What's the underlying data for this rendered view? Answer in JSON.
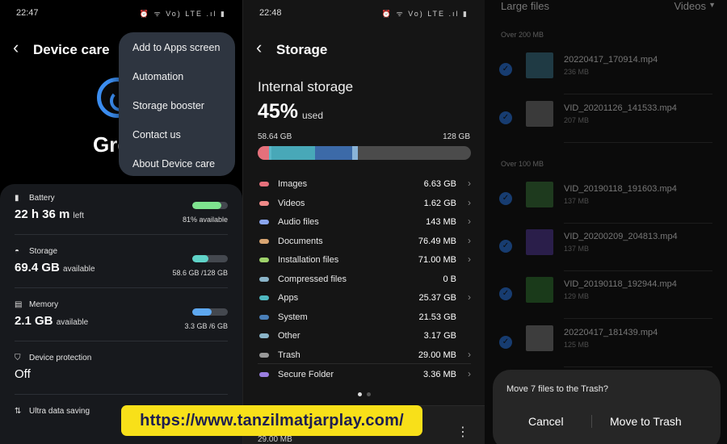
{
  "panel1": {
    "time": "22:47",
    "status_icons": "⏰ ᯤ Vo) LTE .ıl ▮",
    "title": "Device care",
    "greeting": "Gre",
    "menu": [
      "Add to Apps screen",
      "Automation",
      "Storage booster",
      "Contact us",
      "About Device care"
    ],
    "battery": {
      "label": "Battery",
      "value": "22 h 36 m",
      "unit": "left",
      "right": "81% available",
      "level": 81,
      "color": "#7ee38f"
    },
    "storage": {
      "label": "Storage",
      "value": "69.4 GB",
      "unit": "available",
      "right": "58.6 GB /128 GB",
      "level": 46,
      "color": "#5fd3c8"
    },
    "memory": {
      "label": "Memory",
      "value": "2.1 GB",
      "unit": "available",
      "right": "3.3 GB /6 GB",
      "level": 55,
      "color": "#5ea8f0"
    },
    "protection": {
      "label": "Device protection",
      "value": "Off"
    },
    "ultra": {
      "label": "Ultra data saving"
    },
    "url": "https://www.tanzilmatjarplay.com/"
  },
  "panel2": {
    "time": "22:48",
    "status_icons": "⏰ ᯤ Vo) LTE .ıl ▮",
    "title": "Storage",
    "internal_label": "Internal storage",
    "percent": "45%",
    "used_label": "used",
    "used_amount": "58.64 GB",
    "total": "128 GB",
    "bar_segments": [
      {
        "pct": 5.2,
        "color": "#e5707b"
      },
      {
        "pct": 1.3,
        "color": "#5ab8c8"
      },
      {
        "pct": 20.5,
        "color": "#48a8b8"
      },
      {
        "pct": 17.5,
        "color": "#3c6aa8"
      },
      {
        "pct": 2.5,
        "color": "#8ab4d8"
      }
    ],
    "categories": [
      {
        "name": "Images",
        "value": "6.63 GB",
        "color": "#e5707b",
        "chevron": true
      },
      {
        "name": "Videos",
        "value": "1.62 GB",
        "color": "#f08a88",
        "chevron": true
      },
      {
        "name": "Audio files",
        "value": "143 MB",
        "color": "#8aa6f0",
        "chevron": true
      },
      {
        "name": "Documents",
        "value": "76.49 MB",
        "color": "#d9a572",
        "chevron": true
      },
      {
        "name": "Installation files",
        "value": "71.00 MB",
        "color": "#9ed26a",
        "chevron": true
      },
      {
        "name": "Compressed files",
        "value": "0 B",
        "color": "#8ab4c8",
        "chevron": false
      },
      {
        "name": "Apps",
        "value": "25.37 GB",
        "color": "#4fb8c0",
        "chevron": true
      },
      {
        "name": "System",
        "value": "21.53 GB",
        "color": "#4a7fb8",
        "chevron": false
      },
      {
        "name": "Other",
        "value": "3.17 GB",
        "color": "#8ab4c8",
        "chevron": false
      },
      {
        "name": "Trash",
        "value": "29.00 MB",
        "color": "#999999",
        "chevron": true
      },
      {
        "name": "Secure Folder",
        "value": "3.36 MB",
        "color": "#9a7ee0",
        "chevron": true
      }
    ],
    "bottom_size": "29.00 MB"
  },
  "panel3": {
    "header": "Large files",
    "filter": "Videos",
    "sections": [
      {
        "title": "Over 200 MB",
        "files": [
          {
            "name": "20220417_170914.mp4",
            "size": "236 MB",
            "thumb": "#1f3a44"
          },
          {
            "name": "VID_20201126_141533.mp4",
            "size": "207 MB",
            "thumb": "#3a3a3a"
          }
        ]
      },
      {
        "title": "Over 100 MB",
        "files": [
          {
            "name": "VID_20190118_191603.mp4",
            "size": "137 MB",
            "thumb": "#1e3a1e"
          },
          {
            "name": "VID_20200209_204813.mp4",
            "size": "137 MB",
            "thumb": "#2a1e4a"
          },
          {
            "name": "VID_20190118_192944.mp4",
            "size": "129 MB",
            "thumb": "#1a3a1a"
          },
          {
            "name": "20220417_181439.mp4",
            "size": "125 MB",
            "thumb": "#3d3d3d"
          }
        ]
      }
    ],
    "dialog": {
      "question": "Move 7 files to the Trash?",
      "cancel": "Cancel",
      "confirm": "Move to Trash"
    }
  }
}
